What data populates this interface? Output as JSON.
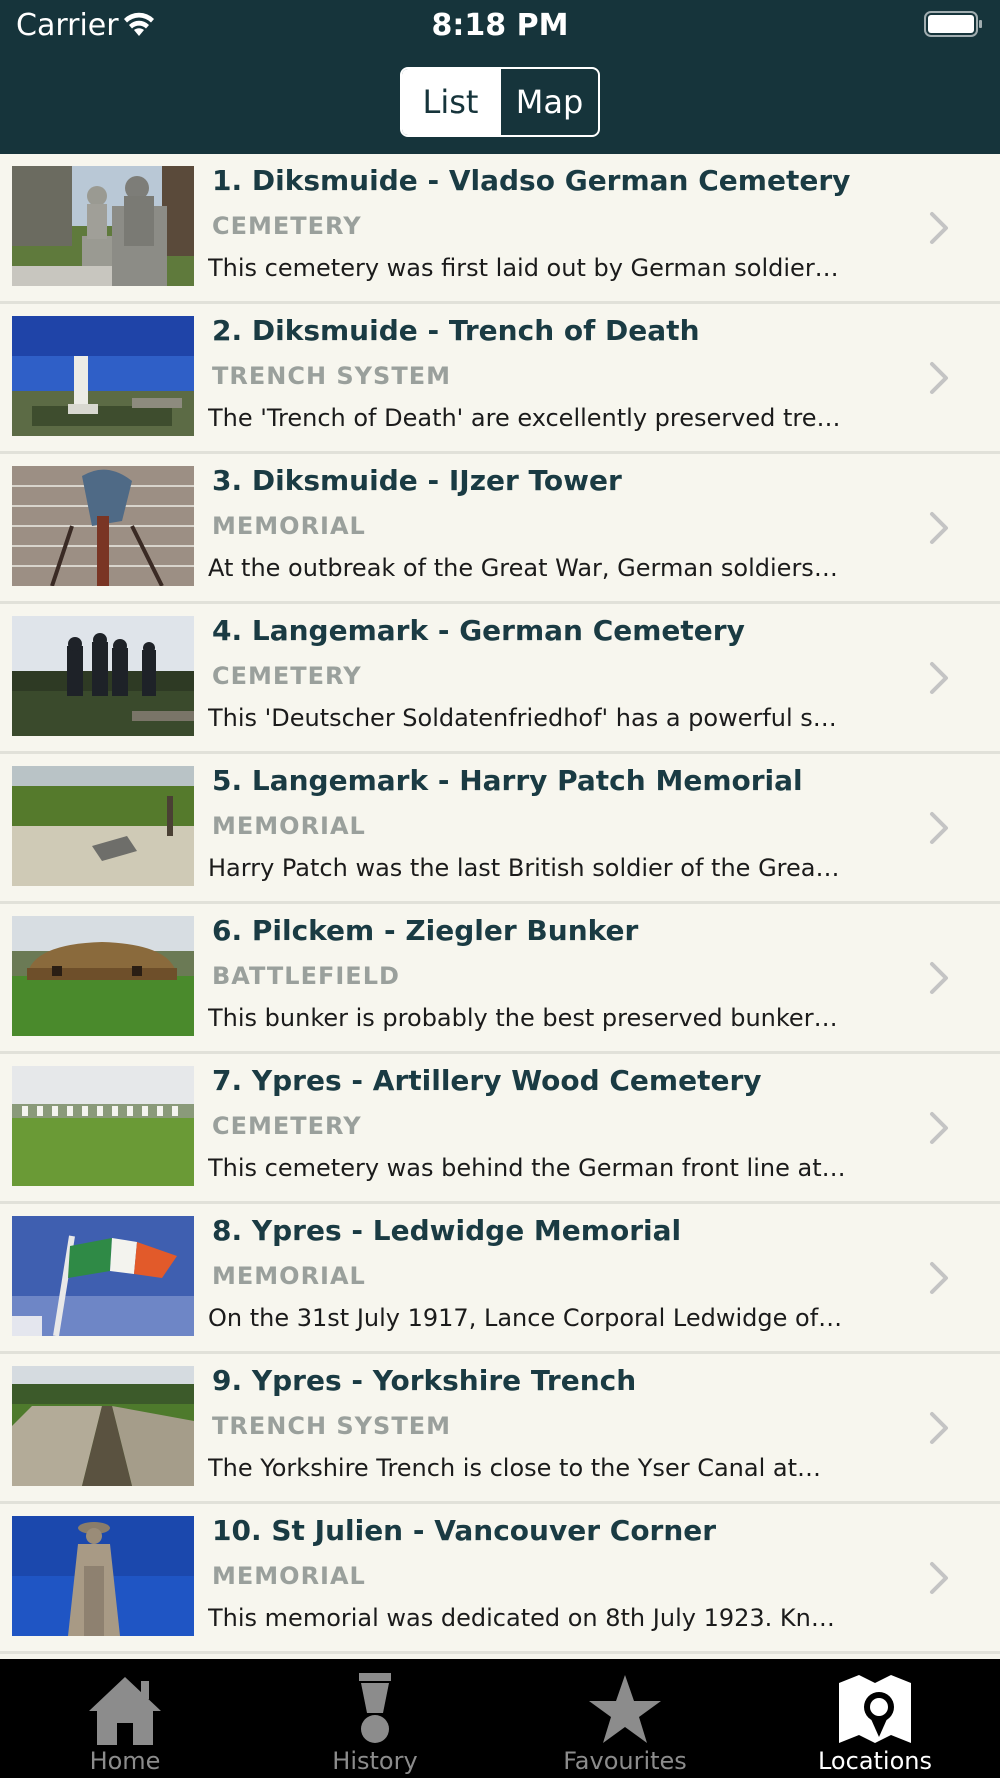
{
  "status_bar": {
    "carrier": "Carrier",
    "time": "8:18 PM"
  },
  "segments": {
    "list": "List",
    "map": "Map"
  },
  "locations": [
    {
      "title": "1. Diksmuide - Vladso German Cemetery",
      "category": "CEMETERY",
      "description": "This cemetery was first laid out by German soldier…"
    },
    {
      "title": "2. Diksmuide - Trench of Death",
      "category": "TRENCH SYSTEM",
      "description": "The 'Trench of Death' are excellently preserved tre…"
    },
    {
      "title": "3. Diksmuide - IJzer Tower",
      "category": "MEMORIAL",
      "description": "At the outbreak of the Great War, German soldiers…"
    },
    {
      "title": "4. Langemark - German Cemetery",
      "category": "CEMETERY",
      "description": "This 'Deutscher Soldatenfriedhof' has a powerful s…"
    },
    {
      "title": "5. Langemark - Harry Patch Memorial",
      "category": "MEMORIAL",
      "description": "Harry Patch was the last British soldier of the Grea…"
    },
    {
      "title": "6. Pilckem - Ziegler Bunker",
      "category": "BATTLEFIELD",
      "description": "This bunker is probably the best preserved bunker…"
    },
    {
      "title": "7. Ypres - Artillery Wood Cemetery",
      "category": "CEMETERY",
      "description": "This cemetery was behind the German front line at…"
    },
    {
      "title": "8. Ypres - Ledwidge Memorial",
      "category": "MEMORIAL",
      "description": "On the 31st July 1917, Lance Corporal Ledwidge of…"
    },
    {
      "title": "9. Ypres - Yorkshire Trench",
      "category": "TRENCH SYSTEM",
      "description": "The Yorkshire Trench is close to the Yser Canal at…"
    },
    {
      "title": "10. St Julien - Vancouver Corner",
      "category": "MEMORIAL",
      "description": "This memorial was dedicated on 8th July 1923. Kn…"
    }
  ],
  "tabs": [
    {
      "label": "Home",
      "icon": "home-icon"
    },
    {
      "label": "History",
      "icon": "history-icon"
    },
    {
      "label": "Favourites",
      "icon": "star-icon"
    },
    {
      "label": "Locations",
      "icon": "map-pin-icon",
      "active": true
    }
  ],
  "colors": {
    "header": "#16343b",
    "title": "#1a3b43",
    "category": "#9aa09c",
    "tabbar": "#000000"
  }
}
